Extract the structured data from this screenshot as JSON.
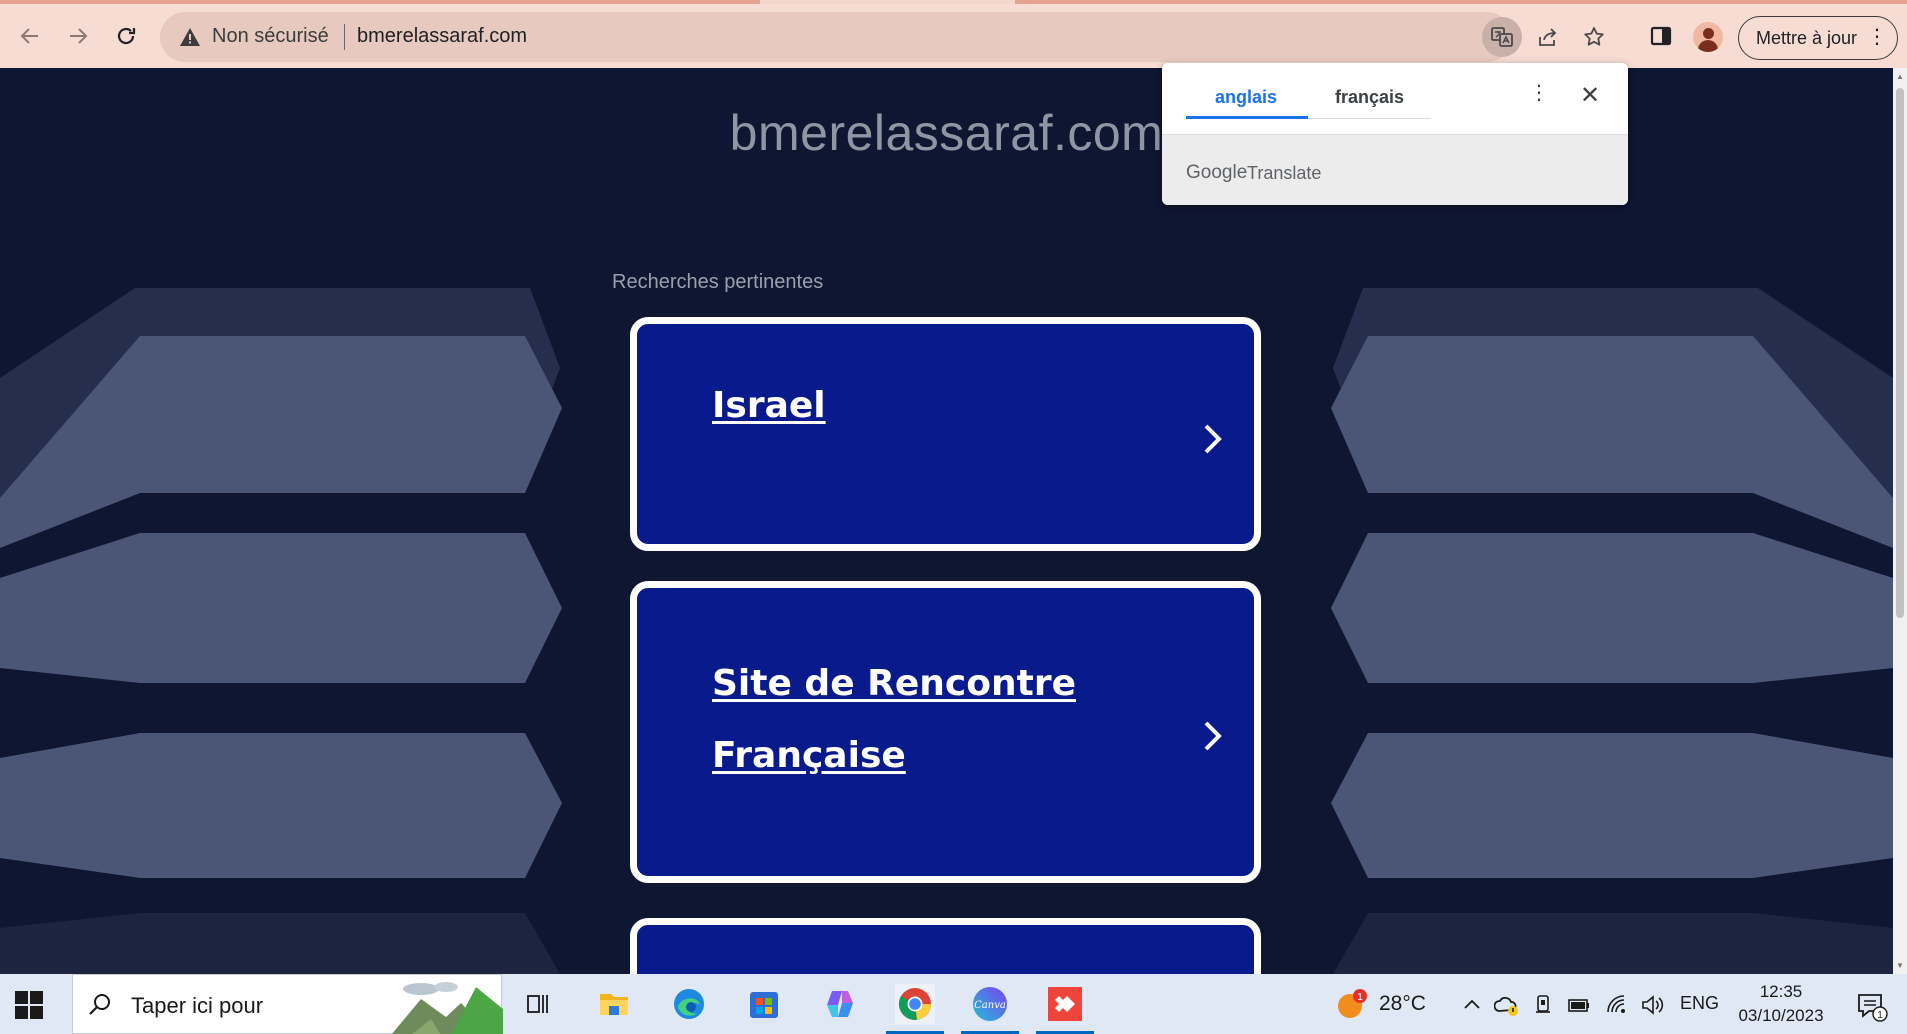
{
  "browser": {
    "omnibox": {
      "security_label": "Non sécurisé",
      "url": "bmerelassaraf.com"
    },
    "update_button_label": "Mettre à jour",
    "icons": [
      "back-arrow-icon",
      "forward-arrow-icon",
      "reload-icon",
      "warning-triangle-icon",
      "translate-icon",
      "share-icon",
      "bookmark-star-icon",
      "side-panel-icon",
      "profile-avatar-icon",
      "more-vert-icon"
    ]
  },
  "translate_popup": {
    "source_language": "anglais",
    "target_language": "français",
    "brand_google": "Google",
    "brand_translate": "Translate",
    "accent_color": "#1a73e8"
  },
  "page": {
    "site_title": "bmerelassaraf.com",
    "related_heading": "Recherches pertinentes",
    "cards": [
      {
        "line1": "Israel",
        "line2": ""
      },
      {
        "line1": "Site de Rencontre",
        "line2": "Française"
      },
      {
        "line1": "",
        "line2": ""
      }
    ],
    "colors": {
      "background": "#0f1631",
      "card": "#081a8c",
      "card_border": "#ffffff",
      "shapes": "#4b5677"
    }
  },
  "taskbar": {
    "search_placeholder": "Taper ici pour",
    "apps": [
      "task-view-icon",
      "file-explorer-icon",
      "edge-icon",
      "microsoft-store-icon",
      "copilot-icon",
      "chrome-icon",
      "canva-icon",
      "anydesk-icon"
    ],
    "canva_label": "Canva",
    "weather": {
      "temperature": "28°C",
      "badge": "1"
    },
    "language": "ENG",
    "time": "12:35",
    "date": "03/10/2023",
    "notification_count": "1"
  }
}
